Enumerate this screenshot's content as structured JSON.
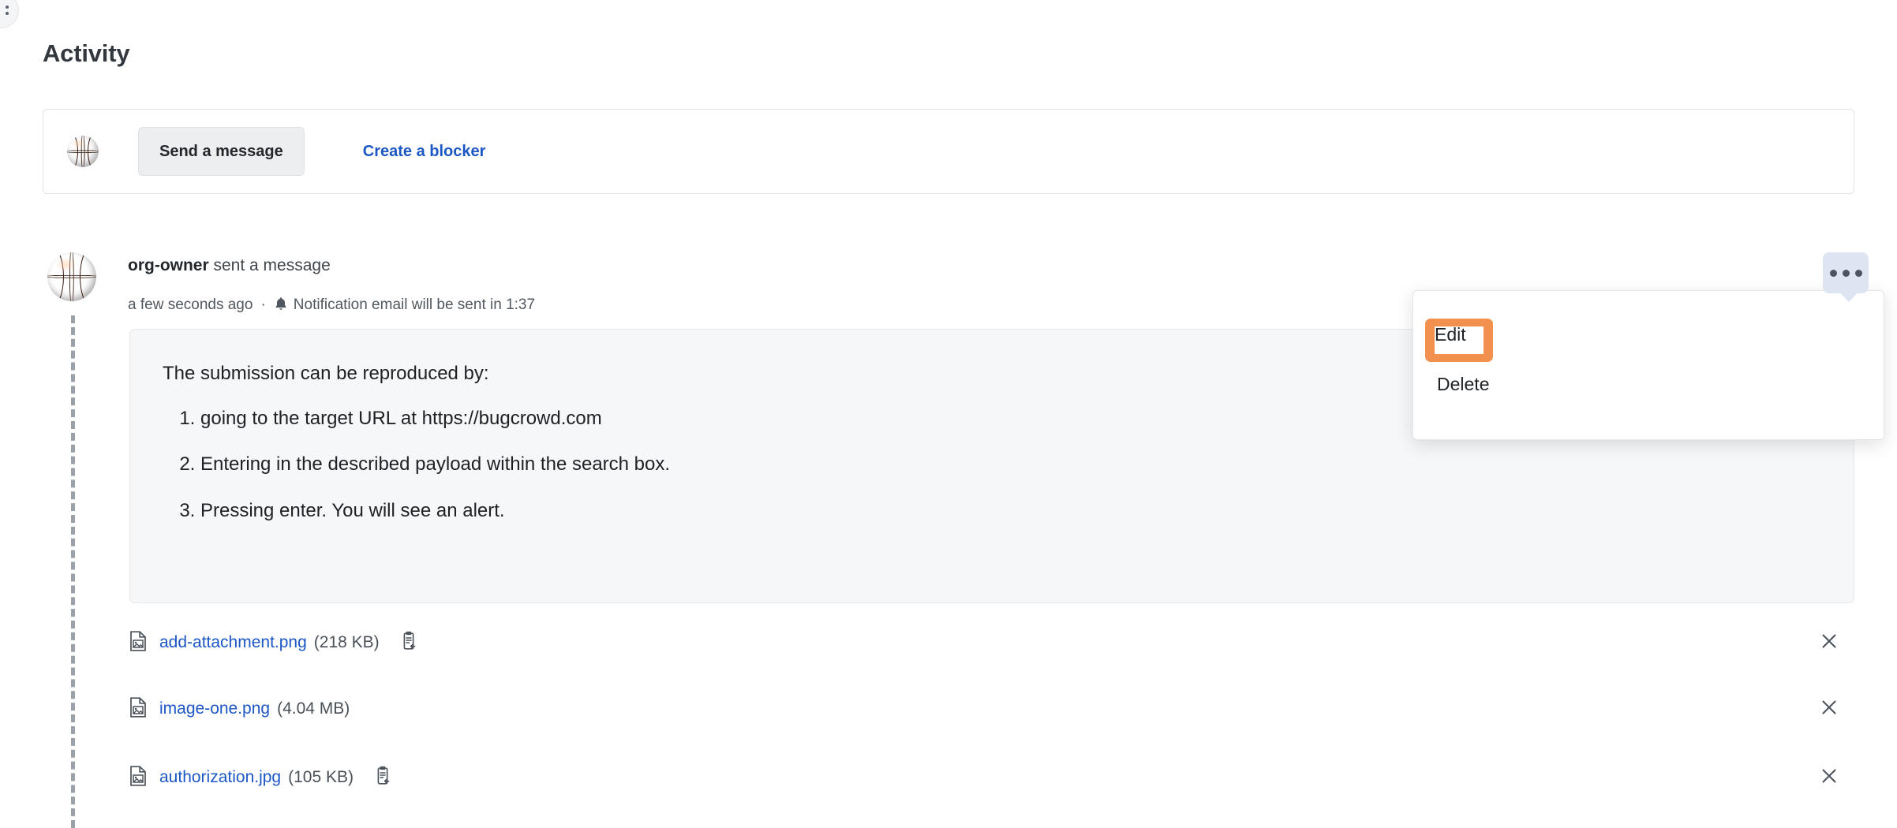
{
  "page": {
    "title": "Activity"
  },
  "edge_control": {
    "icon": "kebab-menu-icon"
  },
  "composer": {
    "avatar_icon": "basketball-avatar",
    "send_message_label": "Send a message",
    "create_blocker_label": "Create a blocker"
  },
  "message": {
    "avatar_icon": "basketball-avatar",
    "author": "org-owner",
    "action_text": " sent a message",
    "timestamp": "a few seconds ago",
    "separator": "·",
    "bell_icon": "bell-icon",
    "notification_text": "Notification email will be sent in 1:37",
    "notification_countdown": "1:37",
    "body": {
      "intro": "The submission can be reproduced by:",
      "steps": [
        "going to the target URL at https://bugcrowd.com",
        "Entering in the described payload within the search box.",
        "Pressing enter. You will see an alert."
      ]
    }
  },
  "attachments": [
    {
      "file_icon": "image-file-icon",
      "name": "add-attachment.png",
      "size": "(218 KB)",
      "has_copy_icon": true,
      "copy_icon": "copy-to-clipboard-icon",
      "remove_icon": "close-icon"
    },
    {
      "file_icon": "image-file-icon",
      "name": "image-one.png",
      "size": "(4.04 MB)",
      "has_copy_icon": false,
      "copy_icon": "",
      "remove_icon": "close-icon"
    },
    {
      "file_icon": "image-file-icon",
      "name": "authorization.jpg",
      "size": "(105 KB)",
      "has_copy_icon": true,
      "copy_icon": "copy-to-clipboard-icon",
      "remove_icon": "close-icon"
    }
  ],
  "menu": {
    "trigger_icon": "ellipsis-horizontal-icon",
    "items": [
      {
        "label": "Edit",
        "highlighted": true
      },
      {
        "label": "Delete",
        "highlighted": false
      }
    ]
  },
  "colors": {
    "link": "#1c57c4",
    "highlight": "#f2904d",
    "trigger_bg": "#dde4f2",
    "body_bg": "#f6f7f8",
    "button_bg": "#eceef0",
    "text": "#1d2125"
  }
}
